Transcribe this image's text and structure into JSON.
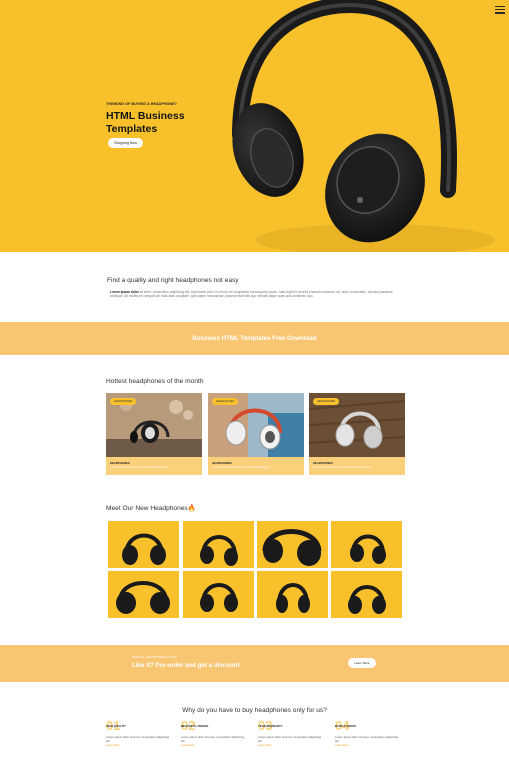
{
  "hero": {
    "kicker": "THINKING OF BUYING A HEADPHONE?",
    "title": "HTML Business Templates",
    "button": "Shopping Now"
  },
  "intro": {
    "heading": "Find a quality and right headphones not easy",
    "lead": "Lorem ipsum dolor",
    "body": " sit amet, consectetur adipiscing elit. Asperiores porro ex rerum vel voluptatem consequatur ipsum. Iusto fugit hic tenetur placeat numquam, ab, dolor consectetur, dolores possimus similique. Ad mollitia et cumque! Ab nulla alias voluptate, quis saepe recusandae, placeat reiciendis quo veritatis atque quas quis architecto quo.."
  },
  "banner": {
    "text": "Business HTML Templates Free Download"
  },
  "hottest": {
    "heading": "Hottest headphones of the month",
    "cards": [
      {
        "tag": "HEADPHONES",
        "name": "HEADPHONES",
        "desc": "Lorem ipsum dolor sit amet, consectetur adipiscing elit."
      },
      {
        "tag": "HEADPHONES",
        "name": "HEADPHONES",
        "desc": "Lorem ipsum dolor sit amet, consectetur adipiscing elit."
      },
      {
        "tag": "HEADPHONES",
        "name": "HEADPHONES",
        "desc": "Lorem ipsum dolor sit amet, consectetur adipiscing elit."
      }
    ]
  },
  "new_section": {
    "heading": "Meet Our New Headphones🔥"
  },
  "preorder": {
    "kicker": "SPECIAL HEADPHONES SALE",
    "heading": "Like it? Pre-order and get a discount",
    "button": "Learn More"
  },
  "why": {
    "heading": "Why do you have to buy headphones only for us?",
    "features": [
      {
        "num": "01",
        "title": "HIGH QUALITY",
        "desc": "Lorem ipsum dolor sit amet, consectetur adipiscing elit.",
        "link": "Learn More"
      },
      {
        "num": "02",
        "title": "BEAUTIFUL DESIGN",
        "desc": "Lorem ipsum dolor sit amet, consectetur adipiscing elit.",
        "link": "Learn More"
      },
      {
        "num": "03",
        "title": "YEAR WARRANTY",
        "desc": "Lorem ipsum dolor sit amet, consectetur adipiscing elit.",
        "link": "Learn More"
      },
      {
        "num": "04",
        "title": "BASS STUDIOS",
        "desc": "Lorem ipsum dolor sit amet, consectetur adipiscing elit.",
        "link": "Learn More"
      }
    ]
  },
  "colors": {
    "brand_yellow": "#f8c12c",
    "soft_yellow": "#f8c673",
    "accent_orange": "#e9a21b"
  },
  "icons": {
    "menu": "hamburger-menu-icon"
  }
}
